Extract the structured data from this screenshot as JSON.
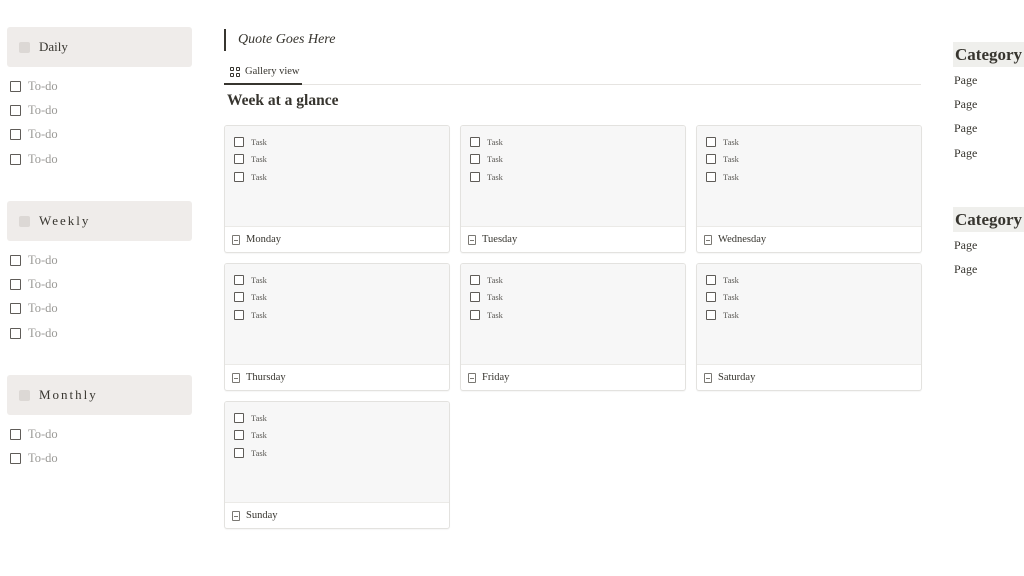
{
  "left": {
    "sections": [
      {
        "title": "Daily",
        "items": [
          "To-do",
          "To-do",
          "To-do",
          "To-do"
        ]
      },
      {
        "title": "Weekly",
        "items": [
          "To-do",
          "To-do",
          "To-do",
          "To-do"
        ]
      },
      {
        "title": "Monthly",
        "items": [
          "To-do",
          "To-do"
        ]
      }
    ]
  },
  "quote": "Quote  Goes Here",
  "view": {
    "tab_label": "Gallery view",
    "title": "Week at a glance",
    "cards": [
      {
        "title": "Monday",
        "tasks": [
          "Task",
          "Task",
          "Task"
        ]
      },
      {
        "title": "Tuesday",
        "tasks": [
          "Task",
          "Task",
          "Task"
        ]
      },
      {
        "title": "Wednesday",
        "tasks": [
          "Task",
          "Task",
          "Task"
        ]
      },
      {
        "title": "Thursday",
        "tasks": [
          "Task",
          "Task",
          "Task"
        ]
      },
      {
        "title": "Friday",
        "tasks": [
          "Task",
          "Task",
          "Task"
        ]
      },
      {
        "title": "Saturday",
        "tasks": [
          "Task",
          "Task",
          "Task"
        ]
      },
      {
        "title": "Sunday",
        "tasks": [
          "Task",
          "Task",
          "Task"
        ]
      }
    ]
  },
  "right": {
    "categories": [
      {
        "title": "Category",
        "pages": [
          "Page",
          "Page",
          "Page",
          "Page"
        ]
      },
      {
        "title": "Category",
        "pages": [
          "Page",
          "Page"
        ]
      }
    ]
  },
  "colors": {
    "text": "#37352f",
    "muted_text": "#9b9a97",
    "section_header_bg": "#efecea",
    "card_preview_bg": "#f7f7f7",
    "category_bg": "#efefec"
  },
  "icons": {
    "section": "square-icon",
    "todo": "checkbox-icon",
    "tab": "gallery-icon",
    "card": "page-icon"
  }
}
